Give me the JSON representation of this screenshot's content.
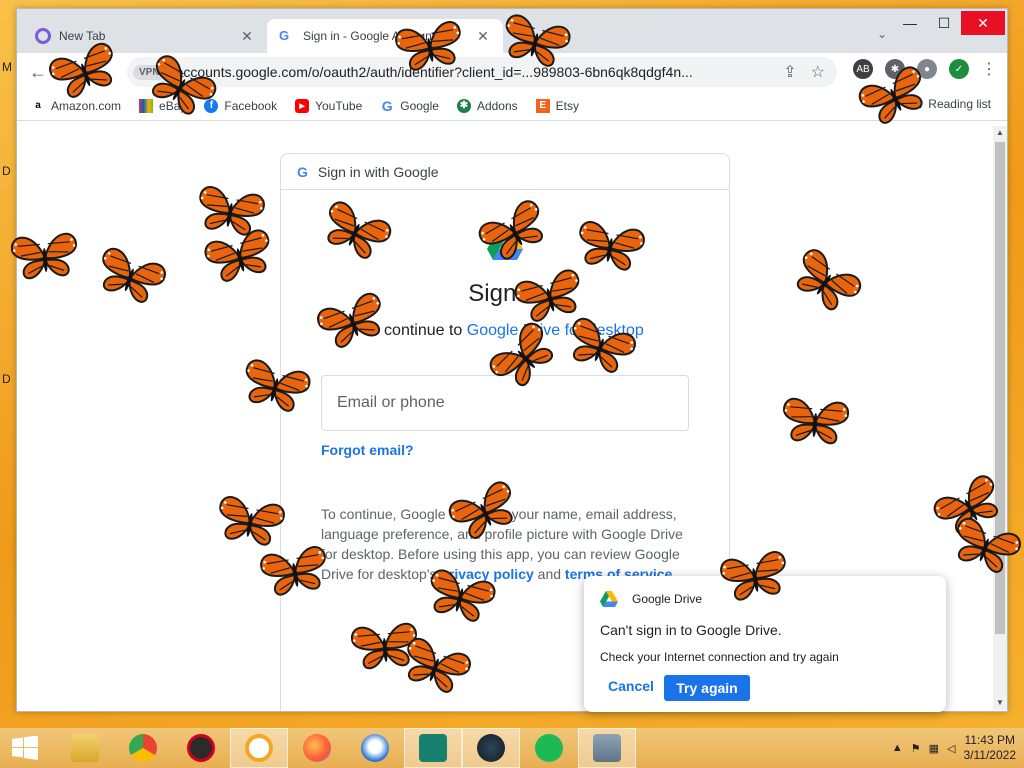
{
  "desktop": {
    "edge_letters": [
      "M",
      "D",
      "D"
    ]
  },
  "browser": {
    "tabs": [
      {
        "label": "New Tab",
        "active": false
      },
      {
        "label": "Sign in - Google Accounts",
        "active": true
      }
    ],
    "window_controls": {
      "minimize": "—",
      "maximize": "☐",
      "close": "✕"
    },
    "url": "accounts.google.com/o/oauth2/auth/identifier?client_id=...989803-6bn6qk8qdgf4n...",
    "vpn_label": "VPN",
    "bookmarks": [
      {
        "label": "Amazon.com",
        "icon": "amazon-icon"
      },
      {
        "label": "eBay",
        "icon": "ebay-icon"
      },
      {
        "label": "Facebook",
        "icon": "facebook-icon"
      },
      {
        "label": "YouTube",
        "icon": "youtube-icon"
      },
      {
        "label": "Google",
        "icon": "google-icon"
      },
      {
        "label": "Addons",
        "icon": "addons-icon"
      },
      {
        "label": "Etsy",
        "icon": "etsy-icon"
      }
    ],
    "reading_list": "Reading list"
  },
  "signin": {
    "header": "Sign in with Google",
    "title": "Sign in",
    "continue_prefix": "to continue to ",
    "continue_app": "Google Drive for desktop",
    "email_placeholder": "Email or phone",
    "forgot_email": "Forgot email?",
    "disclosure_1": "To continue, Google will share your name, email address, language preference, and profile picture with Google Drive for desktop. Before using this app, you can review Google Drive for desktop's ",
    "privacy_link": "privacy policy",
    "disclosure_and": " and ",
    "terms_link": "terms of service",
    "disclosure_end": "."
  },
  "toast": {
    "app": "Google Drive",
    "title": "Can't sign in to Google Drive.",
    "message": "Check your Internet connection and try again",
    "cancel": "Cancel",
    "retry": "Try again"
  },
  "taskbar": {
    "items": [
      "start-button",
      "file-explorer-icon",
      "chrome-icon",
      "red-app-icon",
      "vpn-lock-icon",
      "firefox-icon",
      "thunderbird-icon",
      "shield-app-icon",
      "steam-icon",
      "spotify-icon",
      "network-app-icon"
    ],
    "time": "11:43 PM",
    "date": "3/11/2022"
  },
  "colors": {
    "accent": "#1a73e8",
    "butterfly": "#e8650e"
  }
}
